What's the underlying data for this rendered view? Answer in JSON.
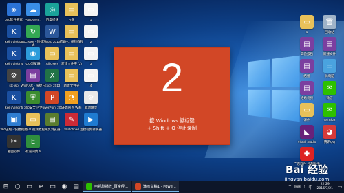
{
  "desktop": {
    "left_icons": [
      {
        "label": "360软件管家",
        "glyph": "◈",
        "color": "#2b73d6"
      },
      {
        "label": "PanDown...",
        "glyph": "☁",
        "color": "#3a8ee6"
      },
      {
        "label": "百度提速",
        "glyph": "◎",
        "color": "#1aa39a"
      },
      {
        "label": "A盘",
        "glyph": "▭",
        "color": "#e8c15a"
      },
      {
        "label": "1",
        "glyph": "▭",
        "color": "#f4f4f4"
      },
      {
        "label": "Keil uVision3",
        "glyph": "K",
        "color": "#1a4fa0"
      },
      {
        "label": "360Cease - 快捷方式",
        "glyph": "↻",
        "color": "#34a853"
      },
      {
        "label": "Word 2013",
        "glyph": "W",
        "color": "#2b579a"
      },
      {
        "label": "结婚V1 视频教程",
        "glyph": "▭",
        "color": "#e8c15a"
      },
      {
        "label": "2",
        "glyph": "▭",
        "color": "#f4f4f4"
      },
      {
        "label": "Keil uVision4",
        "glyph": "K",
        "color": "#1a4fa0"
      },
      {
        "label": "QQ浏览器",
        "glyph": "◉",
        "color": "#2d9cdb"
      },
      {
        "label": "All Users",
        "glyph": "▭",
        "color": "#e8c15a"
      },
      {
        "label": "新建文件夹 (2)",
        "glyph": "▭",
        "color": "#e8c15a"
      },
      {
        "label": "3",
        "glyph": "▭",
        "color": "#f4f4f4"
      },
      {
        "label": "stc-isp",
        "glyph": "⚙",
        "color": "#444444"
      },
      {
        "label": "WinRAR - 快捷方式",
        "glyph": "▤",
        "color": "#7b3fa0"
      },
      {
        "label": "Excel 2013",
        "glyph": "X",
        "color": "#217346"
      },
      {
        "label": "新建文件夹",
        "glyph": "▭",
        "color": "#e8c15a"
      },
      {
        "label": "4",
        "glyph": "▭",
        "color": "#f4f4f4"
      },
      {
        "label": "Keil uVision5",
        "glyph": "K",
        "color": "#1a4fa0"
      },
      {
        "label": "360安全卫士",
        "glyph": "⛨",
        "color": "#3c8d2f"
      },
      {
        "label": "PowerPoint 2013",
        "glyph": "P",
        "color": "#d24726"
      },
      {
        "label": "开始热点 WiFi",
        "glyph": "◔",
        "color": "#f0a020"
      },
      {
        "label": "驱动精灵",
        "glyph": "⚙",
        "color": "#e8e8e8"
      },
      {
        "label": "360压缩 - 快捷方式",
        "glyph": "▣",
        "color": "#2e7dd1"
      },
      {
        "label": "结婚V1 视频教程",
        "glyph": "▭",
        "color": "#e8c15a"
      },
      {
        "label": "网页浏览器",
        "glyph": "▤",
        "color": "#5a7d2f"
      },
      {
        "label": "Sketchpad",
        "glyph": "✎",
        "color": "#cc2a36"
      },
      {
        "label": "迅捷视频转换器",
        "glyph": "▶",
        "color": "#1f7bd1"
      },
      {
        "label": "截图软件",
        "glyph": "✂",
        "color": "#333333"
      },
      {
        "label": "有道词典 5",
        "glyph": "E",
        "color": "#2f8f3e"
      }
    ],
    "right_icons": [
      {
        "label": "1",
        "glyph": "▭",
        "color": "#e8c15a"
      },
      {
        "label": "回收站",
        "glyph": "🗑",
        "color": "#9fb3c8"
      },
      {
        "label": "实验报告",
        "glyph": "▤",
        "color": "#7b3fa0"
      },
      {
        "label": "新建文件",
        "glyph": "▤",
        "color": "#7b3fa0"
      },
      {
        "label": "结婚",
        "glyph": "▤",
        "color": "#7b3fa0"
      },
      {
        "label": "此电脑",
        "glyph": "▭",
        "color": "#4aa3df"
      },
      {
        "label": "结婚视频",
        "glyph": "▤",
        "color": "#7b3fa0"
      },
      {
        "label": "微信",
        "glyph": "✉",
        "color": "#2dc100"
      },
      {
        "label": "课件",
        "glyph": "▭",
        "color": "#e8c15a"
      },
      {
        "label": "WeChat",
        "glyph": "✉",
        "color": "#2dc100"
      },
      {
        "label": "Visual Studio",
        "glyph": "◣",
        "color": "#68217a"
      },
      {
        "label": "腾讯QQ",
        "glyph": "◕",
        "color": "#d63a3a"
      },
      {
        "label": "广东软件 控制助手",
        "glyph": "✚",
        "color": "#d22"
      }
    ]
  },
  "dialog": {
    "number": "2",
    "hint": "按 Windows 徽标键\n+ Shift + Q 停止录制"
  },
  "watermark": {
    "brand": "Bai 经验",
    "site": "jingyan.baidu.com"
  },
  "taskbar": {
    "start_icon": "⊞",
    "search_icon": "○",
    "taskview_icon": "▭",
    "pinned": [
      "e",
      "▭",
      "◉",
      "▤"
    ],
    "tasks": [
      {
        "label": "电视剧播放_百度经...",
        "color": "#2dc100"
      },
      {
        "label": "演示文稿1 - Powe...",
        "color": "#d24726"
      }
    ],
    "tray": [
      "^",
      "⌨",
      "♪",
      "中"
    ],
    "time": "22:29",
    "date": "2016/7/21"
  }
}
